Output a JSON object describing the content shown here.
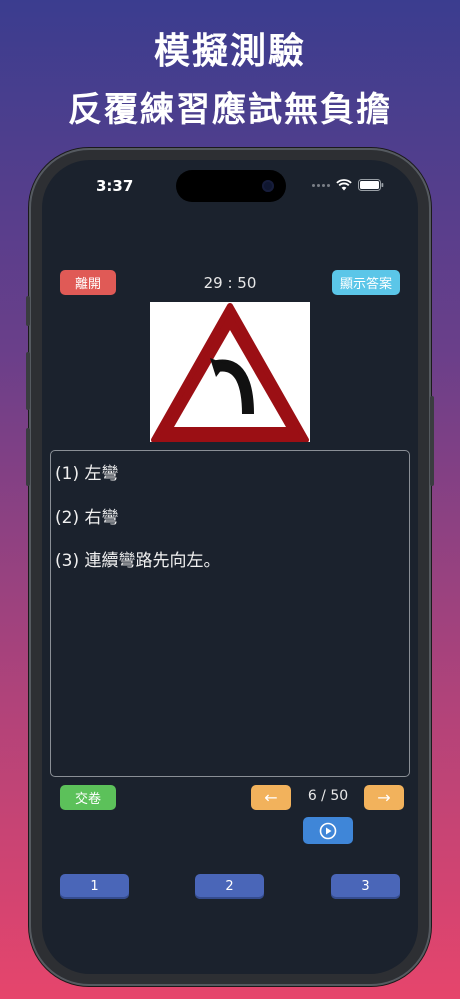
{
  "promo": {
    "title": "模擬測驗",
    "subtitle": "反覆練習應試無負擔"
  },
  "status_bar": {
    "time": "3:37"
  },
  "quiz": {
    "exit_label": "離開",
    "timer": "29 : 50",
    "show_answer_label": "顯示答案",
    "options": [
      "(1) 左彎",
      "(2) 右彎",
      "(3) 連續彎路先向左。"
    ],
    "submit_label": "交卷",
    "prev_label": "←",
    "next_label": "→",
    "page_indicator": "6 / 50",
    "answer_buttons": [
      "1",
      "2",
      "3"
    ]
  },
  "colors": {
    "exit": "#e05a56",
    "show_answer": "#5bc6e8",
    "submit": "#5cc15a",
    "nav": "#f2b25c",
    "play": "#3f86d8",
    "answer_button": "#4a66b8",
    "sign_border": "#9b0f14"
  },
  "icons": {
    "sign": "warning-sign-left-curve",
    "play": "play-icon",
    "wifi": "wifi-icon",
    "battery": "battery-icon"
  }
}
